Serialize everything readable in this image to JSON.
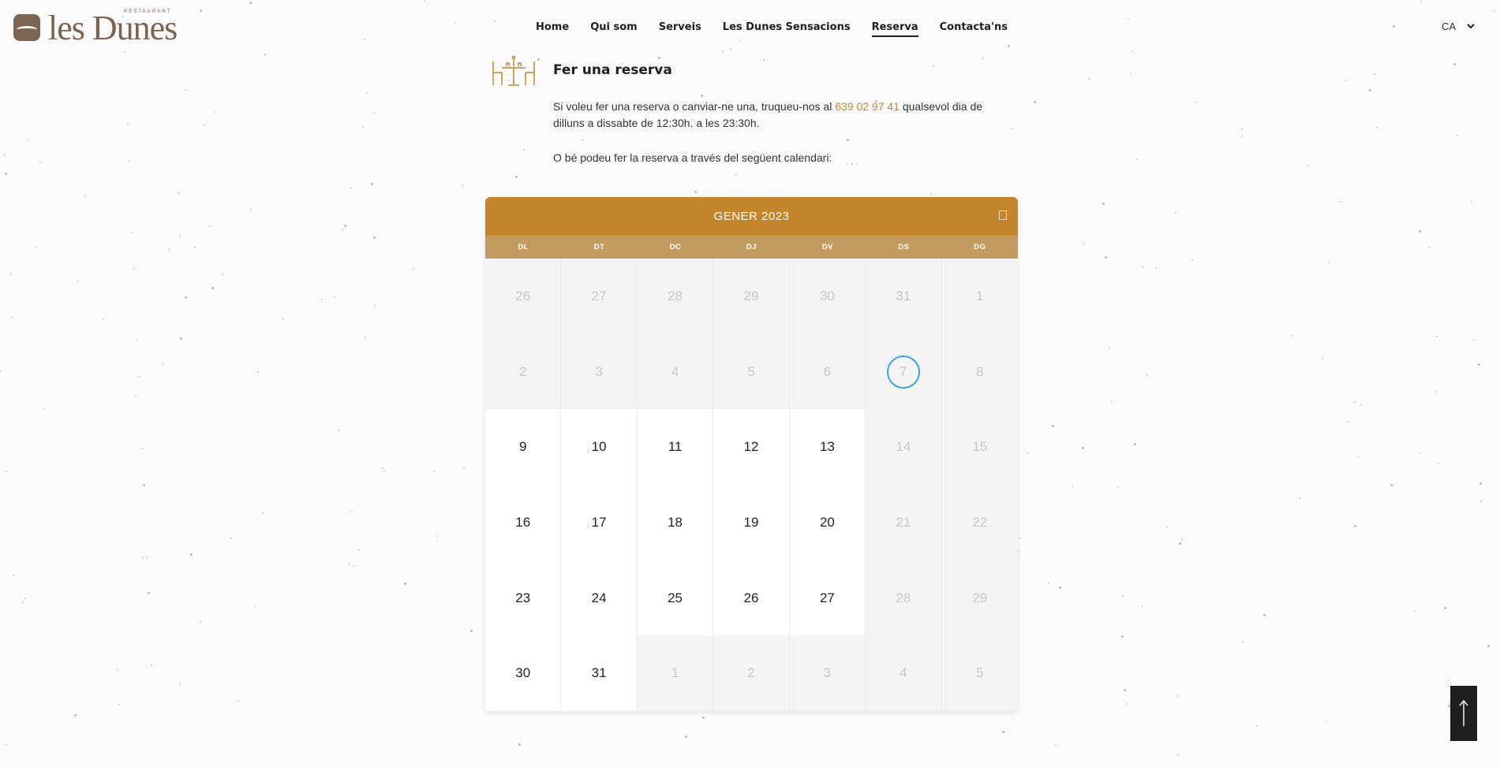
{
  "brand": {
    "name": "les Dunes",
    "tagline": "RESTAURANT"
  },
  "nav": {
    "items": [
      {
        "label": "Home",
        "active": false
      },
      {
        "label": "Qui som",
        "active": false
      },
      {
        "label": "Serveis",
        "active": false
      },
      {
        "label": "Les Dunes Sensacions",
        "active": false
      },
      {
        "label": "Reserva",
        "active": true
      },
      {
        "label": "Contacta'ns",
        "active": false
      }
    ]
  },
  "language": {
    "current": "CA"
  },
  "intro": {
    "title": "Fer una reserva",
    "p1_before": "Si voleu fer una reserva o canviar-ne una, truqueu-nos al ",
    "phone": "639 02 97 41",
    "p1_after": " qualsevol dia de dilluns a dissabte de 12:30h. a les 23:30h.",
    "p2": "O bé podeu fer la reserva a través del següent calendari:"
  },
  "calendar": {
    "month_label": "GENER 2023",
    "weekdays": [
      "DL",
      "DT",
      "DC",
      "DJ",
      "DV",
      "DS",
      "DG"
    ],
    "today": 7,
    "weeks": [
      [
        {
          "d": "26",
          "s": "out"
        },
        {
          "d": "27",
          "s": "out"
        },
        {
          "d": "28",
          "s": "out"
        },
        {
          "d": "29",
          "s": "out"
        },
        {
          "d": "30",
          "s": "out"
        },
        {
          "d": "31",
          "s": "out"
        },
        {
          "d": "1",
          "s": "out"
        }
      ],
      [
        {
          "d": "2",
          "s": "out"
        },
        {
          "d": "3",
          "s": "out"
        },
        {
          "d": "4",
          "s": "out"
        },
        {
          "d": "5",
          "s": "out"
        },
        {
          "d": "6",
          "s": "out"
        },
        {
          "d": "7",
          "s": "today"
        },
        {
          "d": "8",
          "s": "out"
        }
      ],
      [
        {
          "d": "9",
          "s": "open"
        },
        {
          "d": "10",
          "s": "open"
        },
        {
          "d": "11",
          "s": "open"
        },
        {
          "d": "12",
          "s": "open"
        },
        {
          "d": "13",
          "s": "open"
        },
        {
          "d": "14",
          "s": "out"
        },
        {
          "d": "15",
          "s": "out"
        }
      ],
      [
        {
          "d": "16",
          "s": "open"
        },
        {
          "d": "17",
          "s": "open"
        },
        {
          "d": "18",
          "s": "open"
        },
        {
          "d": "19",
          "s": "open"
        },
        {
          "d": "20",
          "s": "open"
        },
        {
          "d": "21",
          "s": "out"
        },
        {
          "d": "22",
          "s": "out"
        }
      ],
      [
        {
          "d": "23",
          "s": "open"
        },
        {
          "d": "24",
          "s": "open"
        },
        {
          "d": "25",
          "s": "open"
        },
        {
          "d": "26",
          "s": "open"
        },
        {
          "d": "27",
          "s": "open"
        },
        {
          "d": "28",
          "s": "out"
        },
        {
          "d": "29",
          "s": "out"
        }
      ],
      [
        {
          "d": "30",
          "s": "open"
        },
        {
          "d": "31",
          "s": "open"
        },
        {
          "d": "1",
          "s": "out"
        },
        {
          "d": "2",
          "s": "out"
        },
        {
          "d": "3",
          "s": "out"
        },
        {
          "d": "4",
          "s": "out"
        },
        {
          "d": "5",
          "s": "out"
        }
      ]
    ]
  },
  "colors": {
    "accent": "#c4862c",
    "weekday_bar": "#c49b5e",
    "today_ring": "#3aa3e0",
    "brand": "#7d6450"
  },
  "icons": {
    "table": "table-chairs-icon",
    "next": "next-month-icon",
    "scroll_top": "arrow-up-icon",
    "lang_chevron": "chevron-down-icon"
  }
}
